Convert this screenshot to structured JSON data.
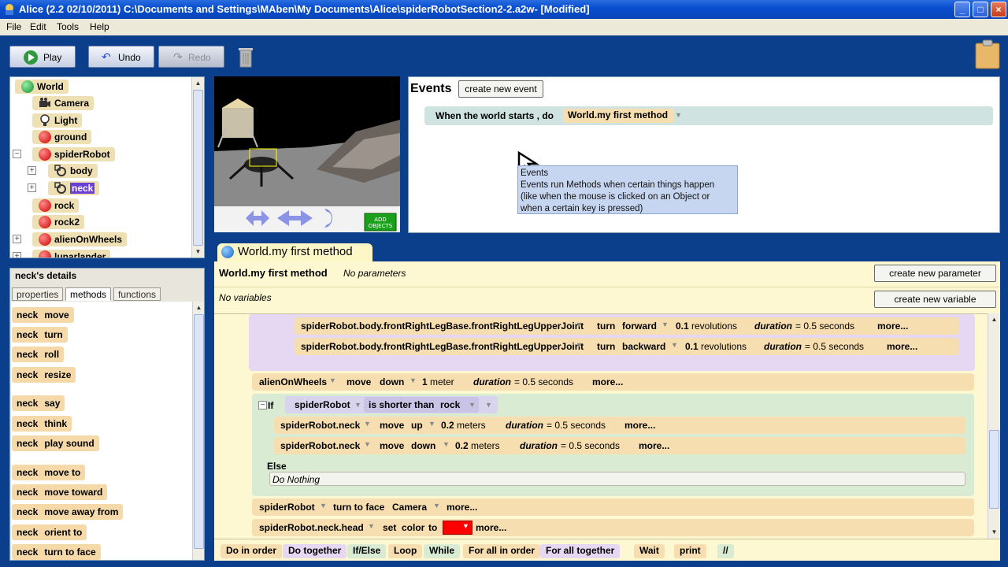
{
  "window": {
    "title": "Alice (2.2  02/10/2011) C:\\Documents and Settings\\MAben\\My Documents\\Alice\\spiderRobotSection2-2.a2w-  [Modified]"
  },
  "menu": {
    "items": [
      "File",
      "Edit",
      "Tools",
      "Help"
    ]
  },
  "toolbar": {
    "play": "Play",
    "undo": "Undo",
    "redo": "Redo"
  },
  "tree": {
    "items": [
      {
        "label": "World",
        "icon": "globe-icon"
      },
      {
        "label": "Camera",
        "icon": "camera-icon"
      },
      {
        "label": "Light",
        "icon": "light-bulb-icon"
      },
      {
        "label": "ground",
        "icon": "object-icon"
      },
      {
        "label": "spiderRobot",
        "icon": "object-icon"
      },
      {
        "label": "body",
        "icon": "part-icon"
      },
      {
        "label": "neck",
        "icon": "part-icon",
        "selected": true
      },
      {
        "label": "rock",
        "icon": "object-icon"
      },
      {
        "label": "rock2",
        "icon": "object-icon"
      },
      {
        "label": "alienOnWheels",
        "icon": "object-icon"
      },
      {
        "label": "lunarlander",
        "icon": "object-icon"
      }
    ]
  },
  "details": {
    "title": "neck's details",
    "tabs": [
      "properties",
      "methods",
      "functions"
    ],
    "active_tab": "methods",
    "object": "neck",
    "methods": [
      "move",
      "turn",
      "roll",
      "resize",
      "say",
      "think",
      "play sound",
      "move to",
      "move   toward",
      "move   away from",
      "orient to",
      "turn to face"
    ]
  },
  "world_view": {
    "add_objects": "ADD OBJECTS"
  },
  "events": {
    "title": "Events",
    "create_button": "create new event",
    "event_label": "When the world starts ,  do",
    "event_method": "World.my first method",
    "tooltip_title": "Events",
    "tooltip_lines": [
      "Events run Methods when certain things happen",
      "(like when the mouse is clicked on an Object or",
      "when a certain key is pressed)"
    ]
  },
  "editor": {
    "tab_label": "World.my first method",
    "method_name": "World.my first method",
    "params_label": "No parameters",
    "vars_label": "No variables",
    "create_parameter": "create new parameter",
    "create_variable": "create new variable",
    "lines": {
      "l1": {
        "obj": "spiderRobot.body.frontRightLegBase.frontRightLegUpperJoint",
        "verb": "turn",
        "dir": "forward",
        "amount": "0.1",
        "unit": "revolutions",
        "dur_label": "duration",
        "dur_val": "= 0.5 seconds",
        "more": "more..."
      },
      "l2": {
        "obj": "spiderRobot.body.frontRightLegBase.frontRightLegUpperJoint",
        "verb": "turn",
        "dir": "backward",
        "amount": "0.1",
        "unit": "revolutions",
        "dur_label": "duration",
        "dur_val": "= 0.5 seconds",
        "more": "more..."
      },
      "l3": {
        "obj": "alienOnWheels",
        "verb": "move",
        "dir": "down",
        "amount": "1",
        "unit": "meter",
        "dur_label": "duration",
        "dur_val": "= 0.5 seconds",
        "more": "more..."
      },
      "if": {
        "kw": "If",
        "obj": "spiderRobot",
        "cond": "is shorter than",
        "target": "rock"
      },
      "l4": {
        "obj": "spiderRobot.neck",
        "verb": "move",
        "dir": "up",
        "amount": "0.2",
        "unit": "meters",
        "dur_label": "duration",
        "dur_val": "= 0.5 seconds",
        "more": "more..."
      },
      "l5": {
        "obj": "spiderRobot.neck",
        "verb": "move",
        "dir": "down",
        "amount": "0.2",
        "unit": "meters",
        "dur_label": "duration",
        "dur_val": "= 0.5 seconds",
        "more": "more..."
      },
      "else": {
        "kw": "Else",
        "body": "Do Nothing"
      },
      "l6": {
        "obj": "spiderRobot",
        "verb": "turn to face",
        "target": "Camera",
        "more": "more..."
      },
      "l7": {
        "obj": "spiderRobot.neck.head",
        "verb": "set",
        "prop": "color",
        "to": "to",
        "more": "more..."
      }
    },
    "color_value": "#ff0000",
    "controls": [
      "Do in order",
      "Do together",
      "If/Else",
      "Loop",
      "While",
      "For all in order",
      "For all together",
      "Wait",
      "print",
      "//"
    ]
  }
}
